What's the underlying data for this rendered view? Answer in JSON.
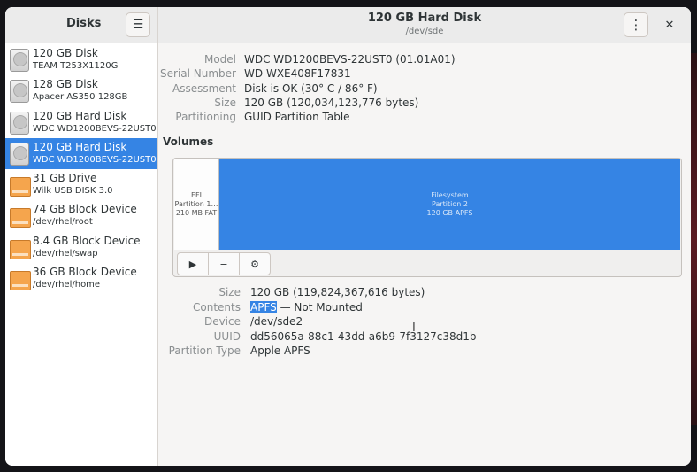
{
  "sidebar": {
    "title": "Disks",
    "menu_icon": "hamburger-menu-icon",
    "disks": [
      {
        "name": "120 GB Disk",
        "sub": "TEAM T253X1120G",
        "icon": "hdd",
        "selected": false
      },
      {
        "name": "128 GB Disk",
        "sub": "Apacer AS350 128GB",
        "icon": "hdd",
        "selected": false
      },
      {
        "name": "120 GB Hard Disk",
        "sub": "WDC WD1200BEVS-22UST0",
        "icon": "hdd",
        "selected": false
      },
      {
        "name": "120 GB Hard Disk",
        "sub": "WDC WD1200BEVS-22UST0",
        "icon": "hdd",
        "selected": true
      },
      {
        "name": "31 GB Drive",
        "sub": "Wilk USB DISK 3.0",
        "icon": "usb",
        "selected": false
      },
      {
        "name": "74 GB Block Device",
        "sub": "/dev/rhel/root",
        "icon": "usb",
        "selected": false
      },
      {
        "name": "8.4 GB Block Device",
        "sub": "/dev/rhel/swap",
        "icon": "usb",
        "selected": false
      },
      {
        "name": "36 GB Block Device",
        "sub": "/dev/rhel/home",
        "icon": "usb",
        "selected": false
      }
    ]
  },
  "header": {
    "title": "120 GB Hard Disk",
    "subtitle": "/dev/sde"
  },
  "drive": {
    "model_label": "Model",
    "model": "WDC WD1200BEVS-22UST0 (01.01A01)",
    "serial_label": "Serial Number",
    "serial": "WD-WXE408F17831",
    "assessment_label": "Assessment",
    "assessment": "Disk is OK (30° C / 86° F)",
    "size_label": "Size",
    "size": "120 GB (120,034,123,776 bytes)",
    "partitioning_label": "Partitioning",
    "partitioning": "GUID Partition Table"
  },
  "volumes": {
    "title": "Volumes",
    "efi": {
      "line1": "EFI",
      "line2": "Partition 1…",
      "line3": "210 MB FAT"
    },
    "main": {
      "line1": "Filesystem",
      "line2": "Partition 2",
      "line3": "120 GB APFS"
    }
  },
  "partition": {
    "size_label": "Size",
    "size": "120 GB (119,824,367,616 bytes)",
    "contents_label": "Contents",
    "contents_type": "APFS",
    "contents_rest": " — Not Mounted",
    "device_label": "Device",
    "device": "/dev/sde2",
    "uuid_label": "UUID",
    "uuid": "dd56065a-88c1-43dd-a6b9-7f3127c38d1b",
    "ptype_label": "Partition Type",
    "ptype": "Apple APFS"
  },
  "colors": {
    "accent": "#3584e4",
    "usb": "#f5a54d"
  }
}
